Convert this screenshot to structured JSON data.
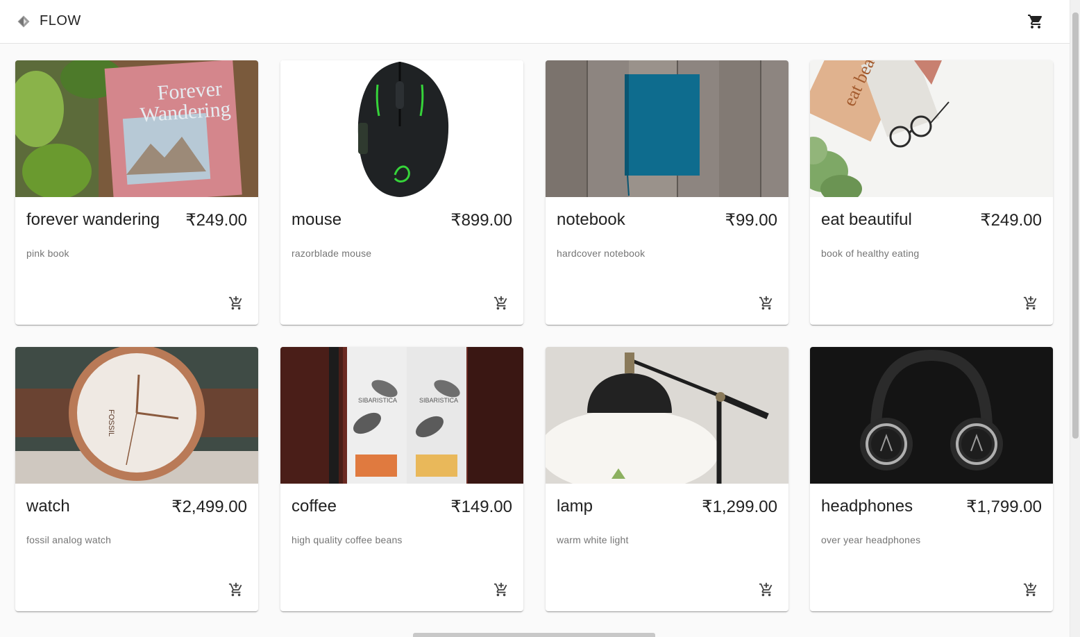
{
  "app": {
    "brand": "FLOW",
    "logo_icon": "diamond-logo-icon",
    "cart_icon": "shopping-cart-icon"
  },
  "products": [
    {
      "title": "forever wandering",
      "price": "₹249.00",
      "description": "pink book",
      "image": "pink book cover with plants"
    },
    {
      "title": "mouse",
      "price": "₹899.00",
      "description": "razorblade mouse",
      "image": "black gaming mouse"
    },
    {
      "title": "notebook",
      "price": "₹99.00",
      "description": "hardcover notebook",
      "image": "blue notebook on wood"
    },
    {
      "title": "eat beautiful",
      "price": "₹249.00",
      "description": "book of healthy eating",
      "image": "book and glasses"
    },
    {
      "title": "watch",
      "price": "₹2,499.00",
      "description": "fossil analog watch",
      "image": "rose gold analog watch"
    },
    {
      "title": "coffee",
      "price": "₹149.00",
      "description": "high quality coffee beans",
      "image": "two coffee bags"
    },
    {
      "title": "lamp",
      "price": "₹1,299.00",
      "description": "warm white light",
      "image": "black desk lamp"
    },
    {
      "title": "headphones",
      "price": "₹1,799.00",
      "description": "over year headphones",
      "image": "black headphones"
    }
  ],
  "colors": {
    "background": "#fafafa",
    "card": "#ffffff",
    "text": "#212121",
    "secondary_text": "#757575"
  }
}
